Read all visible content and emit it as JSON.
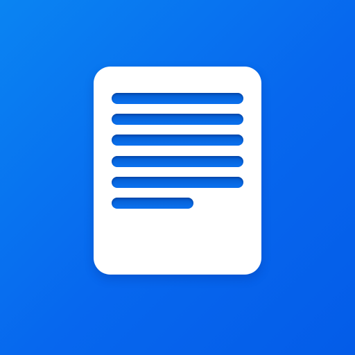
{
  "icon": {
    "name": "document-icon",
    "background_colors": [
      "#0A84F2",
      "#0767EE",
      "#045CE8"
    ],
    "page_color": "#FFFFFF",
    "line_color": "#0A6DEB",
    "line_count": 6
  }
}
